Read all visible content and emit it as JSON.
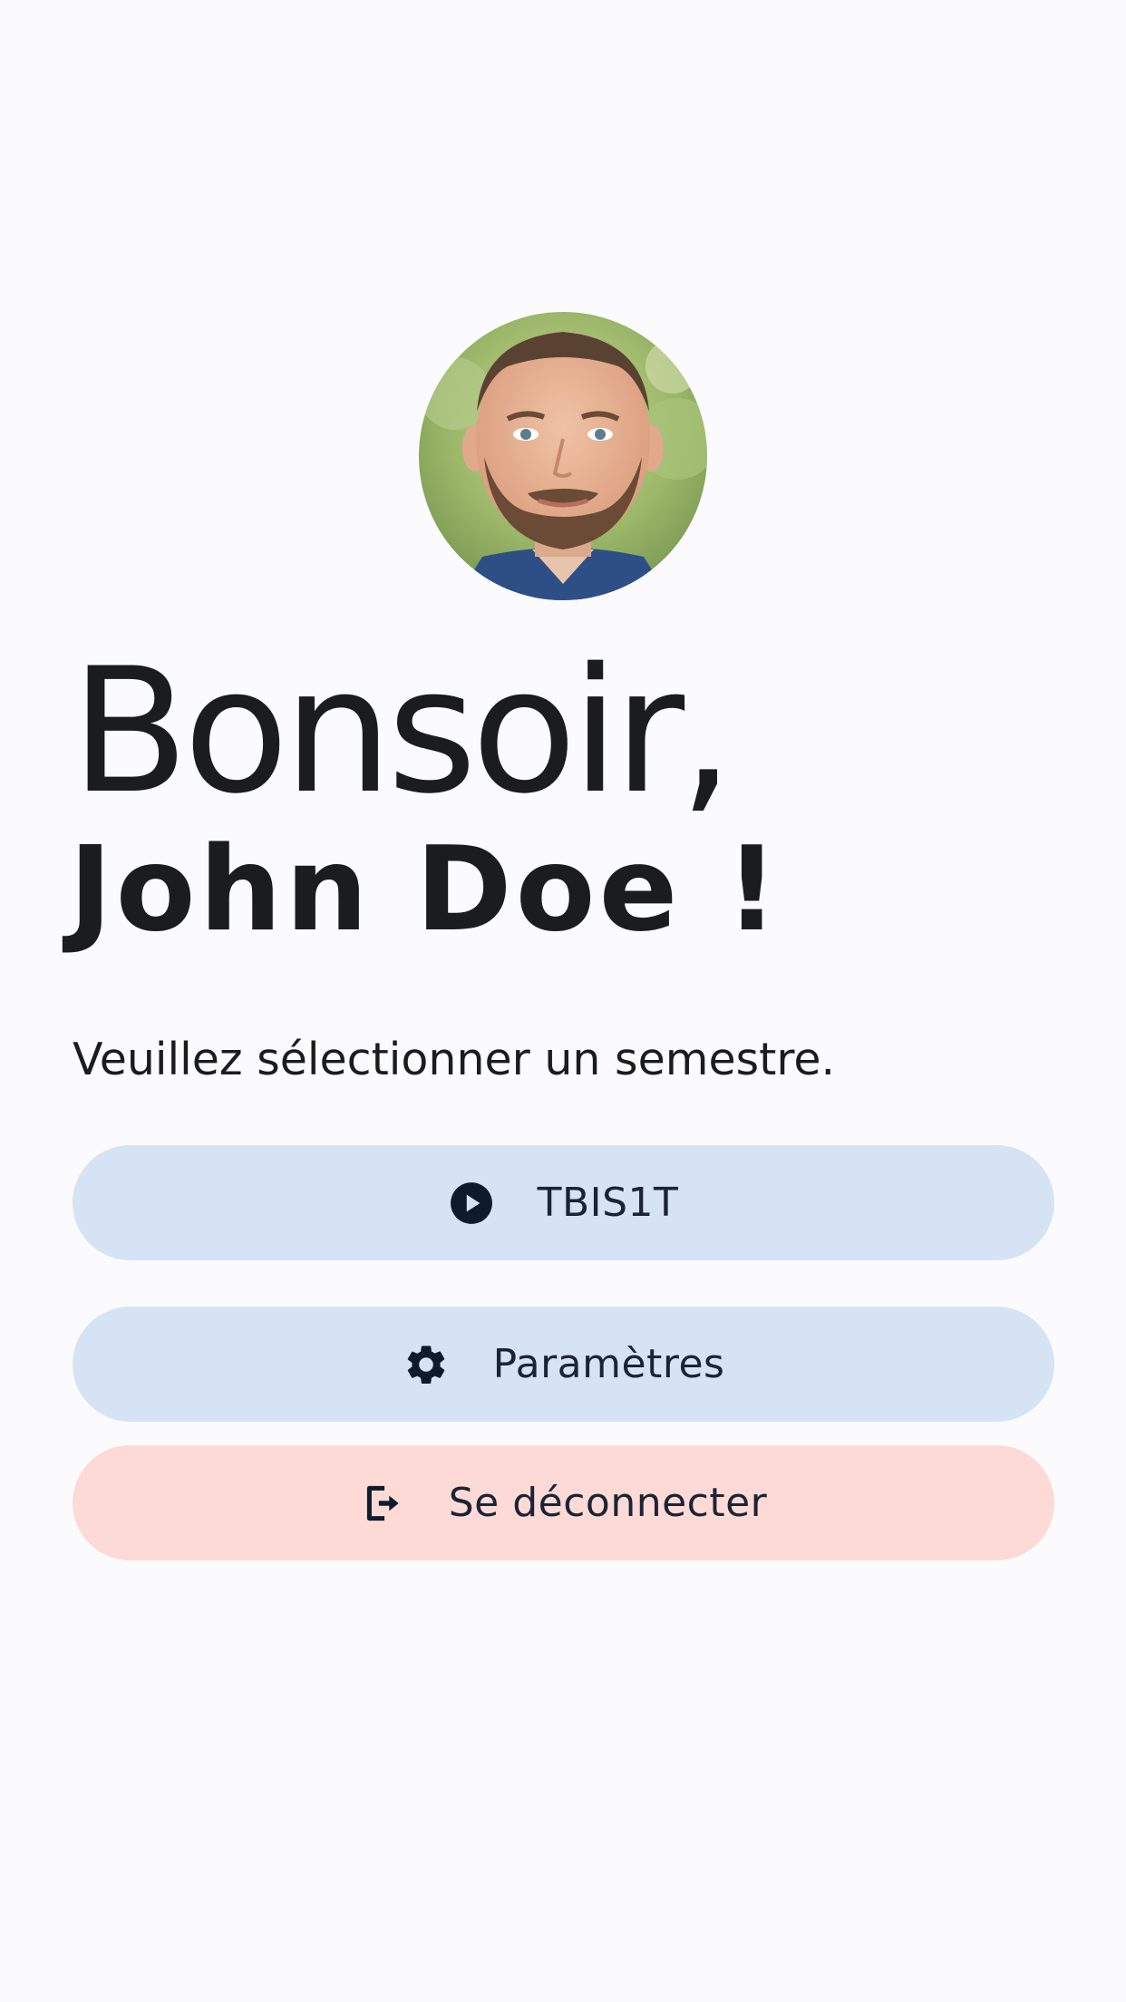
{
  "profile": {
    "avatar_alt": "Photo de profil"
  },
  "greeting": {
    "salutation": "Bonsoir,",
    "name": "John Doe !"
  },
  "prompt": "Veuillez sélectionner un semestre.",
  "actions": [
    {
      "label": "TBIS1T",
      "icon": "play-circle-icon",
      "color": "#d6e3f4"
    },
    {
      "label": "Paramètres",
      "icon": "gear-icon",
      "color": "#d6e3f4"
    },
    {
      "label": "Se déconnecter",
      "icon": "logout-icon",
      "color": "#fddad6"
    }
  ],
  "colors": {
    "background": "#fbfbfd",
    "primary_container": "#d6e3f4",
    "error_container": "#fddad6",
    "on_container": "#1b2434",
    "text": "#1b1c1e"
  }
}
